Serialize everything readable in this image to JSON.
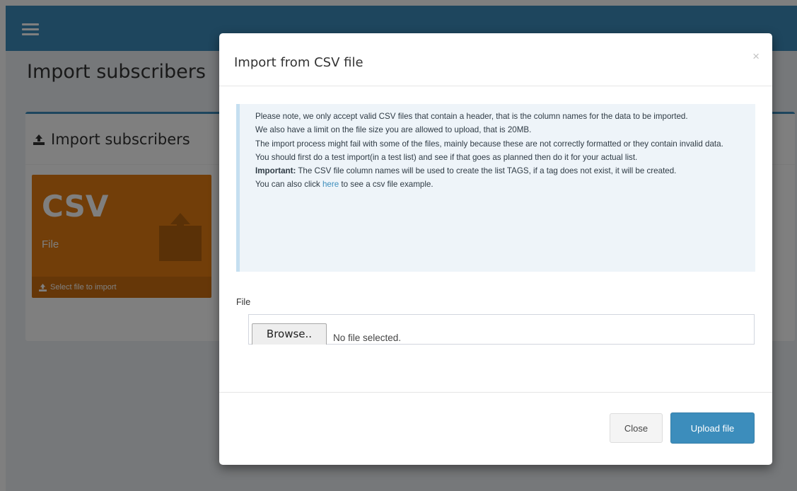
{
  "page": {
    "header_title": "Import subscribers",
    "box_title": "Import subscribers",
    "csv_card": {
      "title": "CSV",
      "subtitle": "File",
      "footer_link": "Select file to import"
    }
  },
  "modal": {
    "title": "Import from CSV file",
    "close_glyph": "×",
    "info": {
      "line1": "Please note, we only accept valid CSV files that contain a header, that is the column names for the data to be imported.",
      "line2": "We also have a limit on the file size you are allowed to upload, that is 20MB.",
      "line3": "The import process might fail with some of the files, mainly because these are not correctly formatted or they contain invalid data.",
      "line4": "You should first do a test import(in a test list) and see if that goes as planned then do it for your actual list.",
      "important_label": "Important:",
      "important_text": " The CSV file column names will be used to create the list TAGS, if a tag does not exist, it will be created.",
      "example_prefix": "You can also click ",
      "example_link": "here",
      "example_suffix": " to see a csv file example."
    },
    "file_label": "File",
    "browse_label": "Browse..",
    "no_file_text": "No file selected.",
    "close_button": "Close",
    "upload_button": "Upload file"
  },
  "colors": {
    "navbar": "#3c8dbc",
    "card": "#e47c12",
    "primary": "#3c8dbc"
  },
  "icons": [
    "menu-icon",
    "upload-icon",
    "close-icon"
  ]
}
